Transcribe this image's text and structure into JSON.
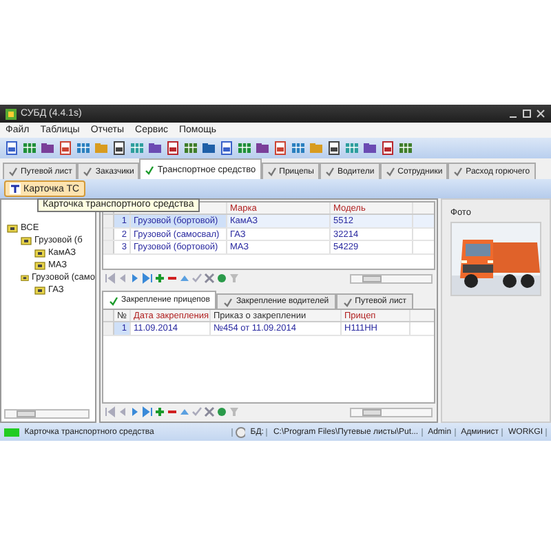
{
  "window": {
    "title": "СУБД (4.4.1s)"
  },
  "menu": [
    "Файл",
    "Таблицы",
    "Отчеты",
    "Сервис",
    "Помощь"
  ],
  "tabs": [
    {
      "label": "Путевой лист",
      "selected": false
    },
    {
      "label": "Заказчики",
      "selected": false
    },
    {
      "label": "Транспортное средство",
      "selected": true
    },
    {
      "label": "Прицепы",
      "selected": false
    },
    {
      "label": "Водители",
      "selected": false
    },
    {
      "label": "Сотрудники",
      "selected": false
    },
    {
      "label": "Расход горючего",
      "selected": false
    }
  ],
  "card_button": "Карточка ТС",
  "tooltip": "Карточка транспортного средства",
  "tree": [
    {
      "label": "ВСЕ",
      "children": [
        {
          "label": "Грузовой (б",
          "children": [
            {
              "label": "КамАЗ"
            },
            {
              "label": "МАЗ"
            }
          ]
        },
        {
          "label": "Грузовой (само",
          "children": [
            {
              "label": "ГАЗ"
            }
          ]
        }
      ]
    }
  ],
  "vehicles": {
    "columns": [
      {
        "label": "Марка",
        "color": "#b02020"
      },
      {
        "label": "Модель",
        "color": "#b02020"
      }
    ],
    "rows": [
      {
        "number": "1",
        "type": "Грузовой (бортовой)",
        "make": "КамАЗ",
        "model": "5512",
        "selected": true
      },
      {
        "number": "2",
        "type": "Грузовой (самосвал)",
        "make": "ГАЗ",
        "model": "32214",
        "selected": false
      },
      {
        "number": "3",
        "type": "Грузовой (бортовой)",
        "make": "МАЗ",
        "model": "54229",
        "selected": false
      }
    ]
  },
  "sub_tabs": [
    {
      "label": "Закрепление прицепов",
      "selected": true
    },
    {
      "label": "Закрепление водителей",
      "selected": false
    },
    {
      "label": "Путевой лист",
      "selected": false
    }
  ],
  "trailers": {
    "columns": [
      {
        "label": "№",
        "color": "#303030"
      },
      {
        "label": "Дата закрепления",
        "color": "#b02020"
      },
      {
        "label": "Приказ о закреплении",
        "color": "#303030"
      },
      {
        "label": "Прицеп",
        "color": "#b02020"
      }
    ],
    "rows": [
      {
        "cells": [
          "1",
          "11.09.2014",
          "№454 от 11.09.2014",
          "Н111НН"
        ],
        "selected": true
      }
    ]
  },
  "photo": {
    "label": "Фото"
  },
  "status_bar": {
    "message": "Карточка транспортного средства",
    "db_label": "БД:",
    "db_path": "C:\\Program Files\\Путевые листы\\Put...",
    "user": "Admin",
    "role": "Админист",
    "workgroup": "WORKGI"
  }
}
